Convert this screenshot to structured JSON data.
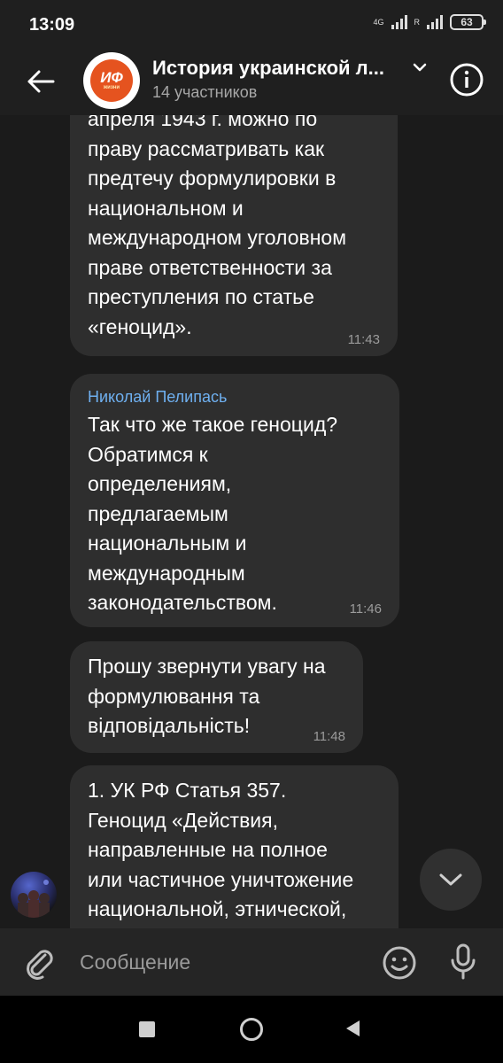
{
  "status_bar": {
    "time": "13:09",
    "network_label": "4G",
    "roaming_label": "R",
    "battery": "63"
  },
  "header": {
    "title": "История украинской л...",
    "subtitle": "14 участников",
    "avatar_text": "ИФ",
    "avatar_subtext": "жизни"
  },
  "messages": [
    {
      "sender": "",
      "lines": [
        "апреля 1943 г. можно по",
        "праву рассматривать как",
        "предтечу формулировки в",
        "национальном и",
        "международном уголовном",
        "праве ответственности за",
        "преступления по статье",
        "«геноцид»."
      ],
      "time": "11:43"
    },
    {
      "sender": "Николай Пелипась",
      "lines": [
        "Так что же такое геноцид?",
        "Обратимся к",
        "определениям,",
        "предлагаемым",
        "национальным и",
        "международным",
        "законодательством."
      ],
      "time": "11:46"
    },
    {
      "sender": "",
      "lines": [
        "Прошу звернути увагу на",
        "формулювання та",
        "відповідальність!"
      ],
      "time": "11:48"
    },
    {
      "sender": "",
      "lines": [
        "1. УК РФ Статья 357.",
        "Геноцид «Действия,",
        "направленные на полное",
        "или частичное уничтожение",
        "национальной, этнической,"
      ],
      "time": ""
    }
  ],
  "input": {
    "placeholder": "Сообщение"
  },
  "colors": {
    "background": "#1b1b1b",
    "bubble": "#2e2e2e",
    "sender_name": "#6fb0f0",
    "avatar_accent": "#e5531f"
  },
  "icons": [
    "back-arrow-icon",
    "chevron-down-icon",
    "info-icon",
    "chevron-down-icon",
    "paperclip-icon",
    "emoji-icon",
    "microphone-icon",
    "nav-recents-icon",
    "nav-home-icon",
    "nav-back-icon"
  ]
}
